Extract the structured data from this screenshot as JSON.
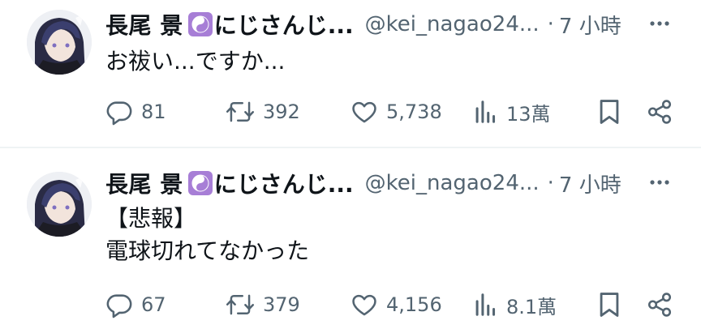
{
  "tweets": [
    {
      "author": {
        "name": "長尾 景",
        "name_suffix": "にじさんじ...",
        "handle": "@kei_nagao24...",
        "separator": "·",
        "time": "7 小時"
      },
      "text_lines": [
        "お祓い...ですか..."
      ],
      "stats": {
        "replies": "81",
        "retweets": "392",
        "likes": "5,738",
        "views": "13萬"
      }
    },
    {
      "author": {
        "name": "長尾 景",
        "name_suffix": "にじさんじ...",
        "handle": "@kei_nagao24...",
        "separator": "·",
        "time": "7 小時"
      },
      "text_lines": [
        "【悲報】",
        "電球切れてなかった"
      ],
      "stats": {
        "replies": "67",
        "retweets": "379",
        "likes": "4,156",
        "views": "8.1萬"
      }
    }
  ],
  "icons": {
    "badge": "yin-yang-icon",
    "more": "more-icon",
    "reply": "reply-icon",
    "retweet": "retweet-icon",
    "like": "heart-icon",
    "views": "views-icon",
    "bookmark": "bookmark-icon",
    "share": "share-icon"
  },
  "colors": {
    "text_primary": "#0f1419",
    "text_secondary": "#536471",
    "badge_bg": "#a77ed6",
    "divider": "#eff3f4"
  }
}
